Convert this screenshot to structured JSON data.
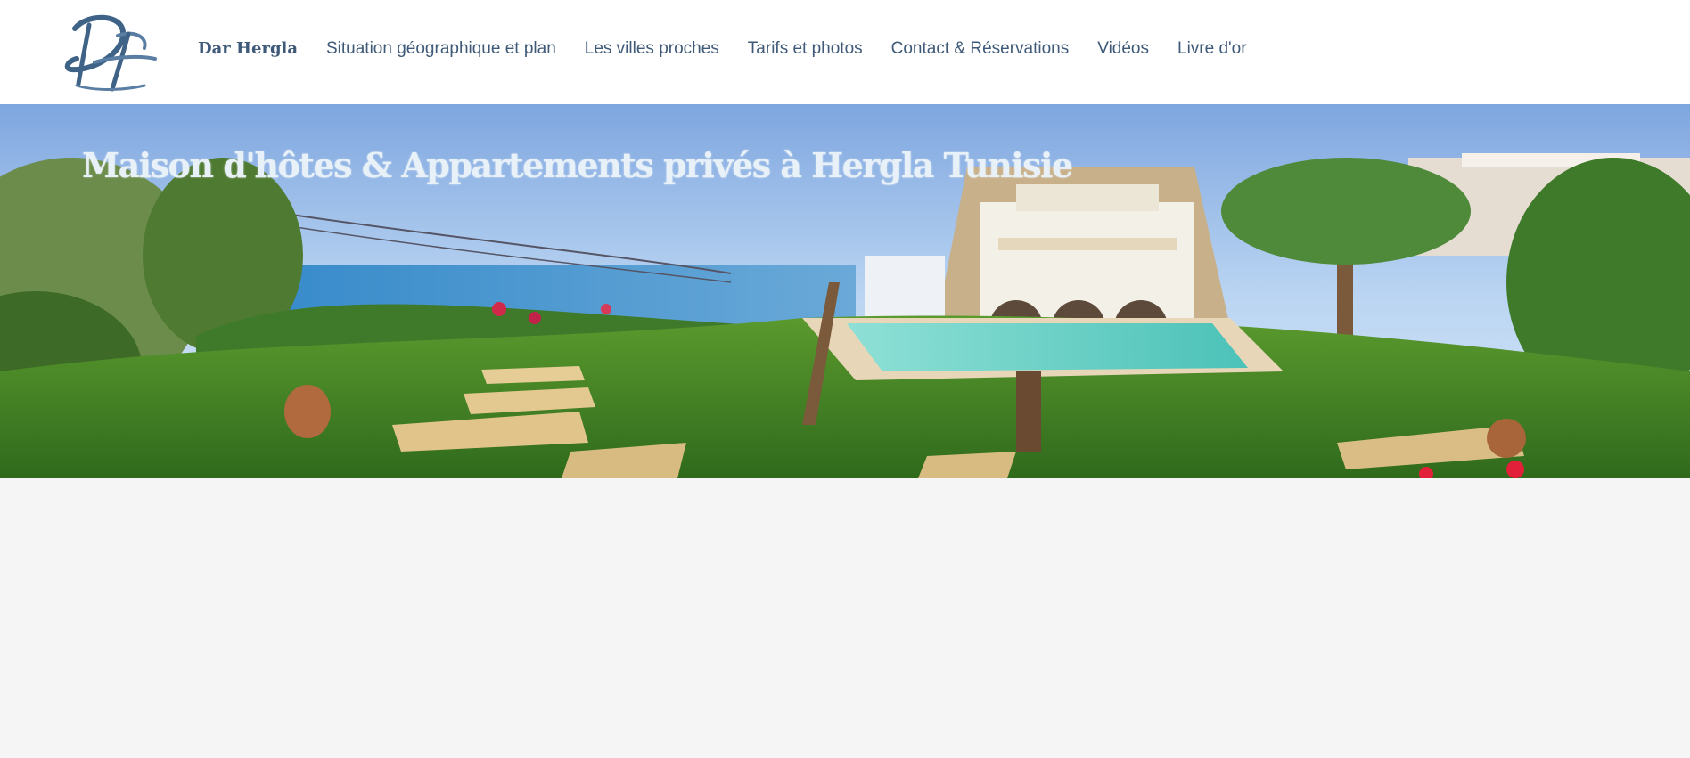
{
  "header": {
    "brand": "Dar Hergla",
    "logo_icon": "dh-monogram-logo",
    "nav": [
      {
        "label": "Situation géographique et plan"
      },
      {
        "label": "Les villes proches"
      },
      {
        "label": "Tarifs et photos"
      },
      {
        "label": "Contact & Réservations"
      },
      {
        "label": "Vidéos"
      },
      {
        "label": "Livre d'or"
      }
    ]
  },
  "hero": {
    "title": "Maison d'hôtes & Appartements privés à Hergla Tunisie"
  },
  "colors": {
    "accent": "#3f5a78",
    "page_background": "#f5f5f5",
    "header_background": "#ffffff"
  }
}
